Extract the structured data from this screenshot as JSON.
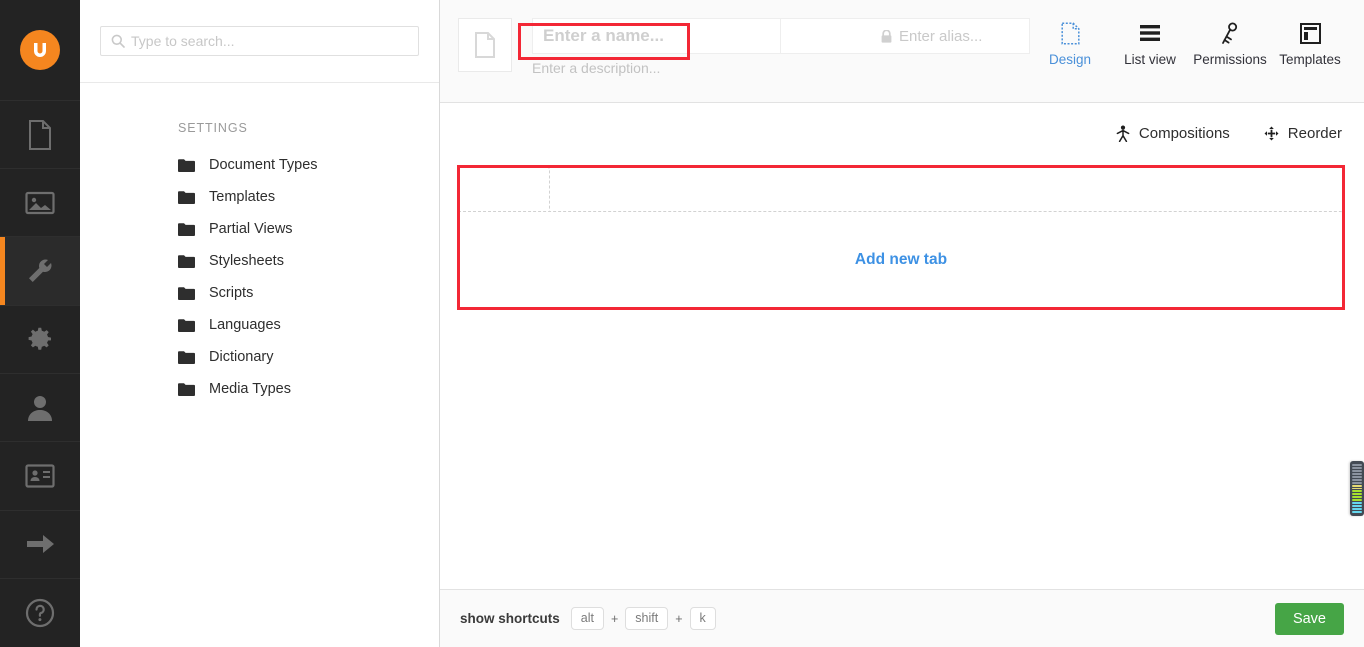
{
  "app": {
    "logo_name": "umbraco-logo",
    "accent_orange": "#f5861f",
    "rail_bg": "#232323"
  },
  "rail": {
    "items": [
      {
        "name": "content",
        "icon": "document-icon",
        "active": false
      },
      {
        "name": "media",
        "icon": "image-icon",
        "active": false
      },
      {
        "name": "settings",
        "icon": "wrench-icon",
        "active": true
      },
      {
        "name": "packages",
        "icon": "gear-icon",
        "active": false
      },
      {
        "name": "users",
        "icon": "user-icon",
        "active": false
      },
      {
        "name": "members",
        "icon": "member-card-icon",
        "active": false
      },
      {
        "name": "forms",
        "icon": "arrow-right-icon",
        "active": false
      },
      {
        "name": "help",
        "icon": "question-circle-icon",
        "active": false
      }
    ]
  },
  "search": {
    "placeholder": "Type to search...",
    "value": "",
    "icon": "search-icon"
  },
  "tree": {
    "heading": "SETTINGS",
    "items": [
      {
        "label": "Document Types",
        "icon": "folder-icon"
      },
      {
        "label": "Templates",
        "icon": "folder-icon"
      },
      {
        "label": "Partial Views",
        "icon": "folder-icon"
      },
      {
        "label": "Stylesheets",
        "icon": "folder-icon"
      },
      {
        "label": "Scripts",
        "icon": "folder-icon"
      },
      {
        "label": "Languages",
        "icon": "folder-icon"
      },
      {
        "label": "Dictionary",
        "icon": "folder-icon"
      },
      {
        "label": "Media Types",
        "icon": "folder-icon"
      }
    ]
  },
  "header": {
    "thumb_icon": "document-outline-icon",
    "name_field": {
      "placeholder": "Enter a name...",
      "value": ""
    },
    "alias_field": {
      "placeholder": "Enter alias...",
      "value": "",
      "icon": "lock-icon"
    },
    "description_field": {
      "placeholder": "Enter a description...",
      "value": ""
    },
    "tabs": [
      {
        "label": "Design",
        "icon": "design-page-icon",
        "active": true
      },
      {
        "label": "List view",
        "icon": "list-view-icon",
        "active": false
      },
      {
        "label": "Permissions",
        "icon": "permissions-key-icon",
        "active": false
      },
      {
        "label": "Templates",
        "icon": "templates-layout-icon",
        "active": false
      }
    ],
    "active_tab_color": "#4a90d9"
  },
  "body": {
    "actions": [
      {
        "label": "Compositions",
        "icon": "compositions-icon"
      },
      {
        "label": "Reorder",
        "icon": "reorder-move-icon"
      }
    ],
    "add_new_tab_label": "Add new tab",
    "add_new_tab_color": "#3d91e4"
  },
  "annotations": {
    "color": "#f32735",
    "boxes": [
      {
        "name": "name-field-highlight"
      },
      {
        "name": "tabs-area-highlight"
      }
    ]
  },
  "minimap": {
    "name": "code-minimap-scrollbar",
    "bg": "#434a54",
    "lines": [
      "#8b93a0",
      "#8b93a0",
      "#8b93a0",
      "#8b93a0",
      "#8b93a0",
      "#8b93a0",
      "#8b93a0",
      "#e6db74",
      "#e6db74",
      "#a6e22e",
      "#a6e22e",
      "#a6e22e",
      "#a6e22e",
      "#66d9ef",
      "#66d9ef",
      "#66d9ef",
      "#66d9ef"
    ]
  },
  "footer": {
    "shortcuts_label": "show shortcuts",
    "keys": [
      "alt",
      "shift",
      "k"
    ],
    "separator": "+",
    "save_label": "Save",
    "save_color": "#46a546"
  }
}
